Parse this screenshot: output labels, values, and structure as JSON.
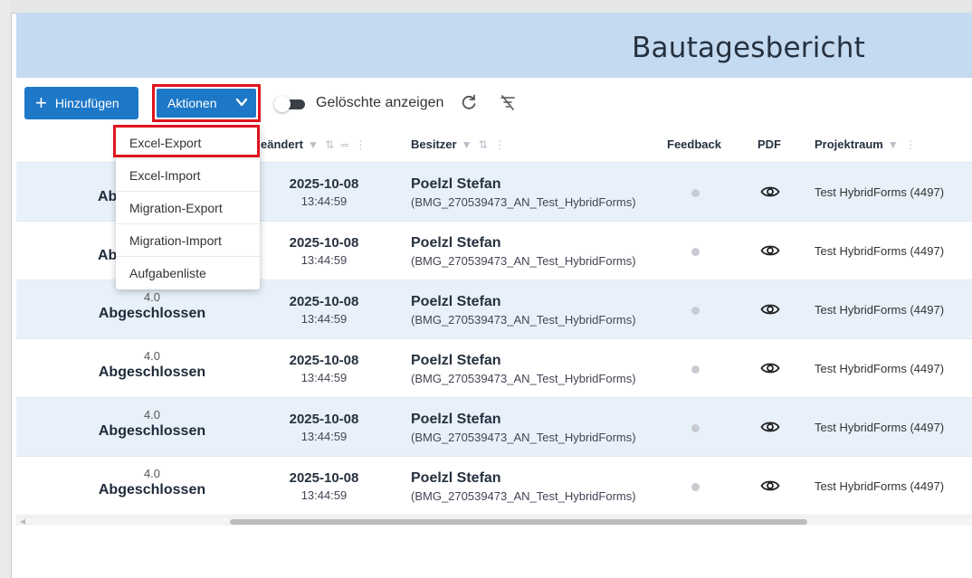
{
  "header": {
    "title": "Bautagesbericht"
  },
  "toolbar": {
    "add_label": "Hinzufügen",
    "actions_label": "Aktionen",
    "show_deleted_label": "Gelöschte anzeigen",
    "show_deleted_on": false
  },
  "actions_menu": {
    "items": [
      "Excel-Export",
      "Excel-Import",
      "Migration-Export",
      "Migration-Import",
      "Aufgabenliste"
    ],
    "highlighted": "Excel-Export"
  },
  "columns": {
    "changed": "eändert",
    "owner": "Besitzer",
    "feedback": "Feedback",
    "pdf": "PDF",
    "project": "Projektraum"
  },
  "rows": [
    {
      "version": "",
      "status": "Abg",
      "date": "2025-10-08",
      "time": "13:44:59",
      "owner": "Poelzl Stefan",
      "owner_user": "(BMG_270539473_AN_Test_HybridForms)",
      "project": "Test HybridForms (4497)"
    },
    {
      "version": "",
      "status": "Abg",
      "date": "2025-10-08",
      "time": "13:44:59",
      "owner": "Poelzl Stefan",
      "owner_user": "(BMG_270539473_AN_Test_HybridForms)",
      "project": "Test HybridForms (4497)"
    },
    {
      "version": "4.0",
      "status": "Abgeschlossen",
      "date": "2025-10-08",
      "time": "13:44:59",
      "owner": "Poelzl Stefan",
      "owner_user": "(BMG_270539473_AN_Test_HybridForms)",
      "project": "Test HybridForms (4497)"
    },
    {
      "version": "4.0",
      "status": "Abgeschlossen",
      "date": "2025-10-08",
      "time": "13:44:59",
      "owner": "Poelzl Stefan",
      "owner_user": "(BMG_270539473_AN_Test_HybridForms)",
      "project": "Test HybridForms (4497)"
    },
    {
      "version": "4.0",
      "status": "Abgeschlossen",
      "date": "2025-10-08",
      "time": "13:44:59",
      "owner": "Poelzl Stefan",
      "owner_user": "(BMG_270539473_AN_Test_HybridForms)",
      "project": "Test HybridForms (4497)"
    },
    {
      "version": "4.0",
      "status": "Abgeschlossen",
      "date": "2025-10-08",
      "time": "13:44:59",
      "owner": "Poelzl Stefan",
      "owner_user": "(BMG_270539473_AN_Test_HybridForms)",
      "project": "Test HybridForms (4497)"
    }
  ],
  "colors": {
    "primary": "#1e78c8",
    "title_bar": "#c4daf0",
    "alt_row": "#e8f1fa",
    "highlight_border": "#e0141e"
  },
  "icons": {
    "add": "plus-icon",
    "actions": "chevron-down-icon",
    "refresh": "refresh-icon",
    "clear_filter": "filter-clear-icon",
    "pdf": "eye-icon",
    "column_filter": "filter-icon",
    "column_sort": "sort-icon",
    "column_menu": "kebab-icon"
  }
}
